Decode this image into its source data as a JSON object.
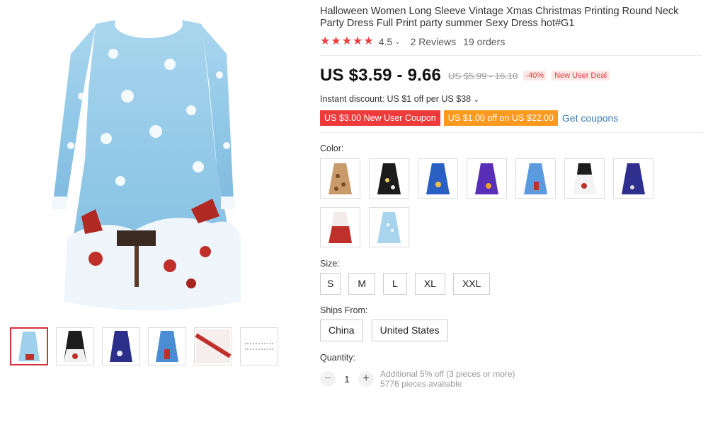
{
  "product": {
    "title": "Halloween Women Long Sleeve Vintage Xmas Christmas Printing Round Neck Party Dress Full Print party summer Sexy Dress hot#G1",
    "rating": "4.5",
    "rating_value": 4.5,
    "reviews": "2 Reviews",
    "orders": "19 orders"
  },
  "price": {
    "current": "US $3.59 - 9.66",
    "original": "US $5.99 - 16.10",
    "discount": "-40%",
    "deal": "New User Deal",
    "instant_discount": "Instant discount: US $1 off per US $38"
  },
  "coupons": {
    "new_user": "US $3.00 New User Coupon",
    "store": "US $1.00 off on US $22.00",
    "get_link": "Get coupons"
  },
  "color": {
    "label": "Color:",
    "options": [
      "tan-floral",
      "black-print",
      "blue-print",
      "purple-print",
      "lightblue-print",
      "white-black",
      "navy-print",
      "red-print",
      "pale-blue"
    ]
  },
  "size": {
    "label": "Size:",
    "options": [
      "S",
      "M",
      "L",
      "XL",
      "XXL"
    ]
  },
  "ships": {
    "label": "Ships From:",
    "options": [
      "China",
      "United States"
    ]
  },
  "quantity": {
    "label": "Quantity:",
    "value": "1",
    "minus": "−",
    "plus": "+",
    "additional": "Additional 5% off (3 pieces or more)",
    "available": "5776 pieces available"
  },
  "icons": {
    "star": "★",
    "chevron": "⌄"
  },
  "colors": {
    "accent_red": "#f03c3c",
    "coupon_red": "#ee3a3a",
    "coupon_orange": "#ff9a1f",
    "link_blue": "#3a7db5"
  }
}
